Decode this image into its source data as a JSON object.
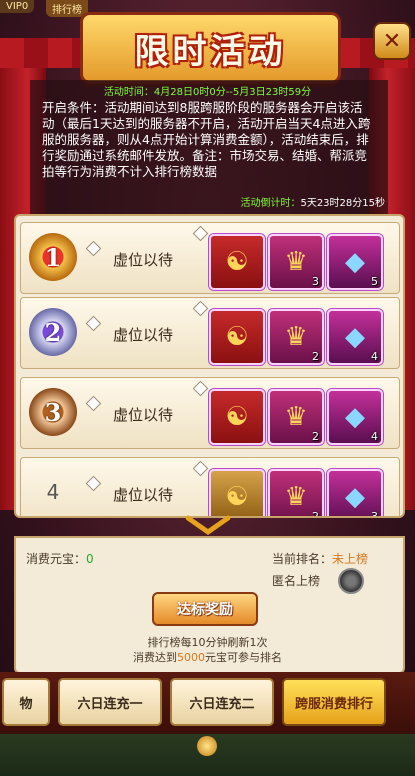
{
  "topbar": {
    "vip": "VIP0",
    "rank_button": "排行榜"
  },
  "title": "限时活动",
  "close_icon": "close-icon",
  "activity_time": "活动时间：4月28日0时0分--5月3日23时59分",
  "description": "开启条件：活动期间达到8服跨服阶段的服务器会开启该活动（最后1天达到的服务器不开启，活动开启当天4点进入跨服的服务器，则从4点开始计算消费金额），活动结束后，排行奖励通过系统邮件发放。备注：市场交易、结婚、帮派竞拍等行为消费不计入排行榜数据",
  "countdown": {
    "label": "活动倒计时：",
    "value": "5天23时28分15秒"
  },
  "ranks": [
    {
      "rank": "1",
      "name": "虚位以待",
      "rewards": [
        {
          "icon": "token-icon",
          "count": ""
        },
        {
          "icon": "helmet-icon",
          "count": "3"
        },
        {
          "icon": "crystal-icon",
          "count": "5"
        }
      ]
    },
    {
      "rank": "2",
      "name": "虚位以待",
      "rewards": [
        {
          "icon": "token-icon",
          "count": ""
        },
        {
          "icon": "helmet-icon",
          "count": "2"
        },
        {
          "icon": "crystal-icon",
          "count": "4"
        }
      ]
    },
    {
      "rank": "3",
      "name": "虚位以待",
      "rewards": [
        {
          "icon": "token-icon",
          "count": ""
        },
        {
          "icon": "helmet-icon",
          "count": "2"
        },
        {
          "icon": "crystal-icon",
          "count": "4"
        }
      ]
    },
    {
      "rank": "4",
      "name": "虚位以待",
      "rewards": [
        {
          "icon": "token-icon",
          "count": ""
        },
        {
          "icon": "helmet-icon",
          "count": "2"
        },
        {
          "icon": "crystal-icon",
          "count": "3"
        }
      ]
    }
  ],
  "summary": {
    "spent_label": "消费元宝：",
    "spent_value": "0",
    "current_rank_label": "当前排名：",
    "current_rank_value": "未上榜",
    "anonymous_label": "匿名上榜",
    "claim_button": "达标奖励",
    "refresh_note": "排行榜每10分钟刷新1次",
    "req_prefix": "消费达到",
    "req_value": "5000",
    "req_suffix": "元宝可参与排名"
  },
  "tabs": [
    {
      "label": "物",
      "active": false
    },
    {
      "label": "六日连充一",
      "active": false
    },
    {
      "label": "六日连充二",
      "active": false
    },
    {
      "label": "跨服消费排行",
      "active": true
    }
  ],
  "colors": {
    "highlight_green": "#7fff3a",
    "accent_orange": "#d8781a",
    "curtain_red": "#c4222a"
  }
}
